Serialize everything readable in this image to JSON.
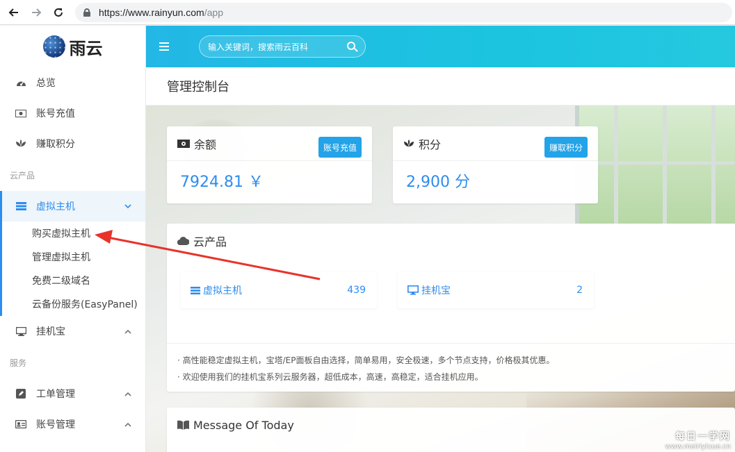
{
  "browser": {
    "url_host": "https://www.rainyun.com",
    "url_path": "/app"
  },
  "sidebar": {
    "brand_name": "雨云",
    "items": [
      {
        "label": "总览",
        "icon": "dashboard-icon"
      },
      {
        "label": "账号充值",
        "icon": "money-icon"
      },
      {
        "label": "赚取积分",
        "icon": "seedling-icon"
      }
    ],
    "section_cloud": "云产品",
    "vhost": {
      "label": "虚拟主机",
      "icon": "server-icon",
      "expanded": true
    },
    "vhost_sub": [
      {
        "label": "购买虚拟主机"
      },
      {
        "label": "管理虚拟主机"
      },
      {
        "label": "免费二级域名"
      },
      {
        "label": "云备份服务(EasyPanel)"
      }
    ],
    "hosting": {
      "label": "挂机宝",
      "icon": "desktop-icon"
    },
    "section_service": "服务",
    "services": [
      {
        "label": "工单管理",
        "icon": "edit-icon"
      },
      {
        "label": "账号管理",
        "icon": "id-card-icon"
      }
    ]
  },
  "topbar": {
    "search_placeholder": "输入关键词，搜索雨云百科"
  },
  "page": {
    "title": "管理控制台"
  },
  "balance_card": {
    "title": "余额",
    "button": "账号充值",
    "value": "7924.81 ￥"
  },
  "points_card": {
    "title": "积分",
    "button": "赚取积分",
    "value": "2,900 分"
  },
  "products_card": {
    "title": "云产品",
    "products": [
      {
        "label": "虚拟主机",
        "count": "439"
      },
      {
        "label": "挂机宝",
        "count": "2"
      }
    ],
    "notes": [
      "· 高性能稳定虚拟主机，宝塔/EP面板自由选择，简单易用，安全极速，多个节点支持，价格极其优惠。",
      "· 欢迎使用我们的挂机宝系列云服务器，超低成本，高速，高稳定，适合挂机应用。"
    ]
  },
  "message_card": {
    "title": "Message Of Today"
  },
  "watermark": {
    "main": "每日一学网",
    "sub": "www.meiriyixue.cn"
  },
  "colors": {
    "accent": "#2d8cf0",
    "topbar": "#23b7e5",
    "button": "#23a3e8",
    "arrow": "#e8332a"
  }
}
